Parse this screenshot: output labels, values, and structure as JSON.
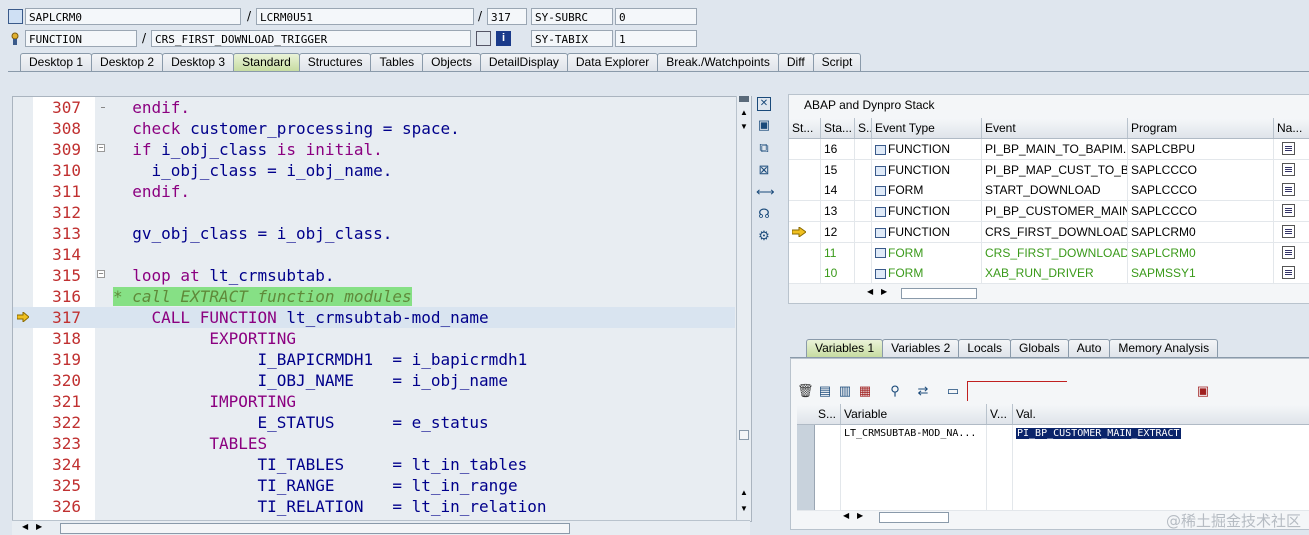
{
  "header": {
    "row1": {
      "program": "SAPLCRM0",
      "include": "LCRM0U51",
      "line": "317",
      "sysfield": "SY-SUBRC",
      "sysvalue": "0"
    },
    "row2": {
      "type": "FUNCTION",
      "name": "CRS_FIRST_DOWNLOAD_TRIGGER",
      "sysfield": "SY-TABIX",
      "sysvalue": "1"
    },
    "separator": "/"
  },
  "tabs": [
    {
      "label": "Desktop 1"
    },
    {
      "label": "Desktop 2"
    },
    {
      "label": "Desktop 3"
    },
    {
      "label": "Standard",
      "active": true
    },
    {
      "label": "Structures"
    },
    {
      "label": "Tables"
    },
    {
      "label": "Objects"
    },
    {
      "label": "DetailDisplay"
    },
    {
      "label": "Data Explorer"
    },
    {
      "label": "Break./Watchpoints"
    },
    {
      "label": "Diff"
    },
    {
      "label": "Script"
    }
  ],
  "code": {
    "lines": [
      {
        "no": "307",
        "html": "  <span class=\"kw\">endif.</span>"
      },
      {
        "no": "308",
        "html": "  <span class=\"kw\">check</span> customer_processing = space."
      },
      {
        "no": "309",
        "html": "  <span class=\"kw\">if</span> i_obj_class <span class=\"kw\">is initial.</span>"
      },
      {
        "no": "310",
        "html": "    i_obj_class = i_obj_name."
      },
      {
        "no": "311",
        "html": "  <span class=\"kw\">endif.</span>"
      },
      {
        "no": "312",
        "html": ""
      },
      {
        "no": "313",
        "html": "  gv_obj_class = i_obj_class."
      },
      {
        "no": "314",
        "html": ""
      },
      {
        "no": "315",
        "html": "  <span class=\"kw\">loop at</span> lt_crmsubtab."
      },
      {
        "no": "316",
        "html": "<span class=\"cmt\">* call EXTRACT function modules</span>"
      },
      {
        "no": "317",
        "html": "    <span class=\"kw\">CALL FUNCTION</span> lt_crmsubtab-mod_name"
      },
      {
        "no": "318",
        "html": "          <span class=\"kw\">EXPORTING</span>"
      },
      {
        "no": "319",
        "html": "               I_BAPICRMDH1  = i_bapicrmdh1"
      },
      {
        "no": "320",
        "html": "               I_OBJ_NAME    = i_obj_name"
      },
      {
        "no": "321",
        "html": "          <span class=\"kw\">IMPORTING</span>"
      },
      {
        "no": "322",
        "html": "               E_STATUS      = e_status"
      },
      {
        "no": "323",
        "html": "          <span class=\"kw\">TABLES</span>"
      },
      {
        "no": "324",
        "html": "               TI_TABLES     = lt_in_tables"
      },
      {
        "no": "325",
        "html": "               TI_RANGE      = lt_in_range"
      },
      {
        "no": "326",
        "html": "               TI_RELATION   = lt_in_relation"
      }
    ],
    "current_line": "317"
  },
  "stack": {
    "title": "ABAP and Dynpro Stack",
    "columns": [
      "St...",
      "Sta...",
      "S..",
      "Event Type",
      "Event",
      "Program",
      "Na..."
    ],
    "rows": [
      {
        "level": "16",
        "type": "FUNCTION",
        "event": "PI_BP_MAIN_TO_BAPIM...",
        "program": "SAPLCBPU"
      },
      {
        "level": "15",
        "type": "FUNCTION",
        "event": "PI_BP_MAP_CUST_TO_B...",
        "program": "SAPLCCCO"
      },
      {
        "level": "14",
        "type": "FORM",
        "event": "START_DOWNLOAD",
        "program": "SAPLCCCO"
      },
      {
        "level": "13",
        "type": "FUNCTION",
        "event": "PI_BP_CUSTOMER_MAIN...",
        "program": "SAPLCCCO"
      },
      {
        "level": "12",
        "type": "FUNCTION",
        "event": "CRS_FIRST_DOWNLOAD...",
        "program": "SAPLCRM0",
        "current": true
      },
      {
        "level": "11",
        "type": "FORM",
        "event": "CRS_FIRST_DOWNLOAD...",
        "program": "SAPLCRM0",
        "green": true
      },
      {
        "level": "10",
        "type": "FORM",
        "event": "XAB_RUN_DRIVER",
        "program": "SAPMSSY1",
        "green": true
      }
    ]
  },
  "var_tabs": [
    {
      "label": "Variables 1",
      "active": true
    },
    {
      "label": "Variables 2"
    },
    {
      "label": "Locals"
    },
    {
      "label": "Globals"
    },
    {
      "label": "Auto"
    },
    {
      "label": "Memory Analysis"
    }
  ],
  "vars": {
    "columns": [
      "S...",
      "Variable",
      "V...",
      "Val."
    ],
    "rows": [
      {
        "variable": "LT_CRMSUBTAB-MOD_NA...",
        "value": "PI_BP_CUSTOMER_MAIN_EXTRACT"
      }
    ]
  },
  "watermark": "@稀土掘金技术社区",
  "colors": {
    "accent_tab": "#c7dca1",
    "keyword": "#8b0080",
    "identifier": "#00008b",
    "comment_bg": "#86e085",
    "linenumber": "#c03030",
    "selected_value": "#0a246a"
  }
}
